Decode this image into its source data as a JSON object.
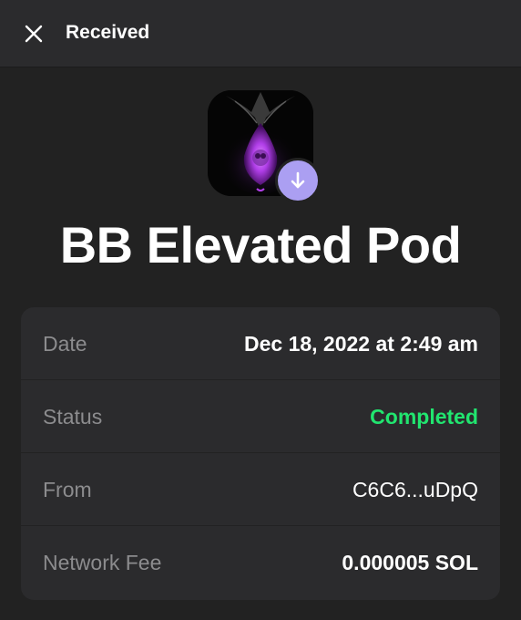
{
  "header": {
    "title": "Received",
    "close_icon": "close-icon"
  },
  "nft": {
    "name": "BB Elevated Pod",
    "badge_icon": "arrow-down-icon",
    "badge_color": "#ab9ff2"
  },
  "details": {
    "date": {
      "label": "Date",
      "value": "Dec 18, 2022 at 2:49 am"
    },
    "status": {
      "label": "Status",
      "value": "Completed",
      "color": "#21e56f"
    },
    "from": {
      "label": "From",
      "value": "C6C6...uDpQ"
    },
    "network_fee": {
      "label": "Network Fee",
      "value": "0.000005 SOL"
    }
  }
}
